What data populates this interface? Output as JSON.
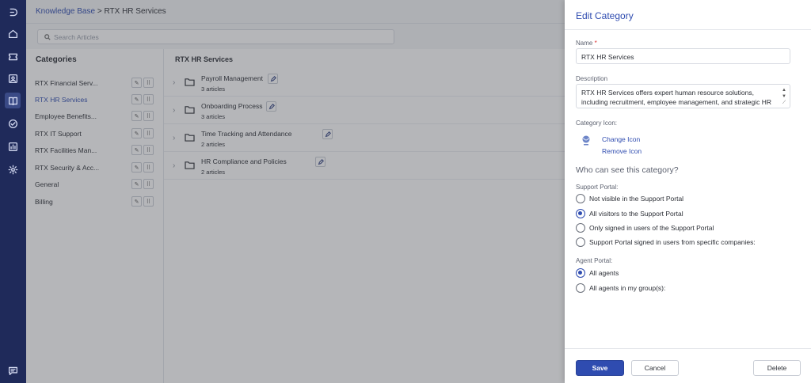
{
  "breadcrumb": {
    "parent": "Knowledge Base",
    "separator": ">",
    "current": "RTX HR Services"
  },
  "search": {
    "placeholder": "Search Articles"
  },
  "sidebar": {
    "title": "Categories",
    "items": [
      {
        "label": "RTX Financial Serv..."
      },
      {
        "label": "RTX HR Services"
      },
      {
        "label": "Employee Benefits..."
      },
      {
        "label": "RTX IT Support"
      },
      {
        "label": "RTX Facilities Man..."
      },
      {
        "label": "RTX Security & Acc..."
      },
      {
        "label": "General"
      },
      {
        "label": "Billing"
      }
    ]
  },
  "content": {
    "title": "RTX HR Services",
    "folders": [
      {
        "name": "Payroll Management",
        "count": "3 articles"
      },
      {
        "name": "Onboarding Process",
        "count": "3 articles"
      },
      {
        "name": "Time Tracking and Attendance",
        "count": "2 articles"
      },
      {
        "name": "HR Compliance and Policies",
        "count": "2 articles"
      }
    ]
  },
  "panel": {
    "title": "Edit Category",
    "name_label": "Name",
    "required_mark": "*",
    "name_value": "RTX HR Services",
    "description_label": "Description",
    "description_value": "RTX HR Services offers expert human resource solutions, including recruitment, employee management, and strategic HR",
    "icon_label": "Category Icon:",
    "change_icon": "Change Icon",
    "remove_icon": "Remove Icon",
    "visibility_heading": "Who can see this category?",
    "support_portal_label": "Support Portal:",
    "support_options": [
      "Not visible in the Support Portal",
      "All visitors to the Support Portal",
      "Only signed in users of the Support Portal",
      "Support Portal signed in users from specific companies:"
    ],
    "support_selected": "All visitors to the Support Portal",
    "agent_portal_label": "Agent Portal:",
    "agent_options": [
      "All agents",
      "All agents in my group(s):"
    ],
    "agent_selected": "All agents",
    "save_label": "Save",
    "cancel_label": "Cancel",
    "delete_label": "Delete"
  },
  "nav_icons": [
    "logo-icon",
    "home-icon",
    "tickets-icon",
    "contacts-icon",
    "knowledge-base-icon",
    "tasks-icon",
    "reports-icon",
    "settings-icon",
    "chat-icon"
  ],
  "colors": {
    "rail": "#1f2a5a",
    "accent": "#2f4cb0"
  }
}
